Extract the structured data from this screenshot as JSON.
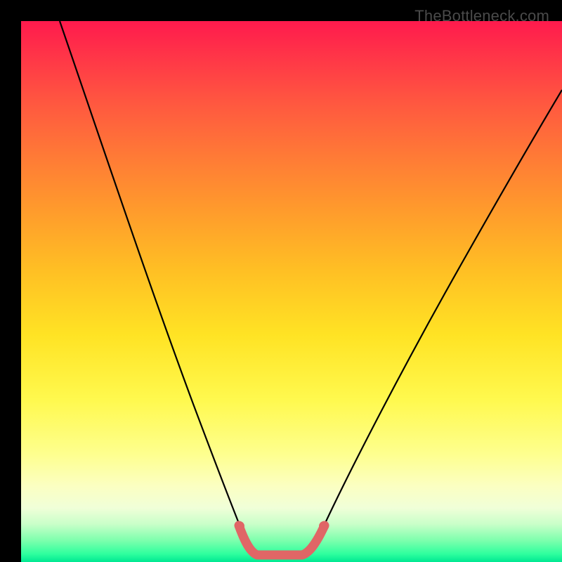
{
  "watermark": "TheBottleneck.com",
  "colors": {
    "curve": "#000000",
    "marker": "#e06666",
    "markerFill": "#e06666"
  },
  "chart_data": {
    "type": "line",
    "title": "",
    "xlabel": "",
    "ylabel": "",
    "xlim": [
      0,
      100
    ],
    "ylim": [
      0,
      100
    ],
    "series": [
      {
        "name": "bottleneck-curve",
        "x": [
          0,
          5,
          10,
          15,
          20,
          25,
          30,
          33,
          36,
          38,
          40,
          42,
          44,
          47,
          50,
          53,
          57,
          62,
          68,
          75,
          82,
          90,
          100
        ],
        "y": [
          100,
          88,
          76,
          65,
          54,
          44,
          33,
          25,
          18,
          11,
          5,
          1,
          0,
          0,
          1,
          4,
          9,
          15,
          23,
          32,
          41,
          50,
          60
        ]
      }
    ],
    "highlight": {
      "name": "optimal-range",
      "x": [
        40,
        41,
        42,
        43,
        44,
        45,
        46,
        47,
        48,
        49,
        50,
        51
      ],
      "y": [
        5,
        3,
        1,
        0.5,
        0,
        0,
        0,
        0,
        0.5,
        1,
        1.5,
        3
      ]
    }
  }
}
